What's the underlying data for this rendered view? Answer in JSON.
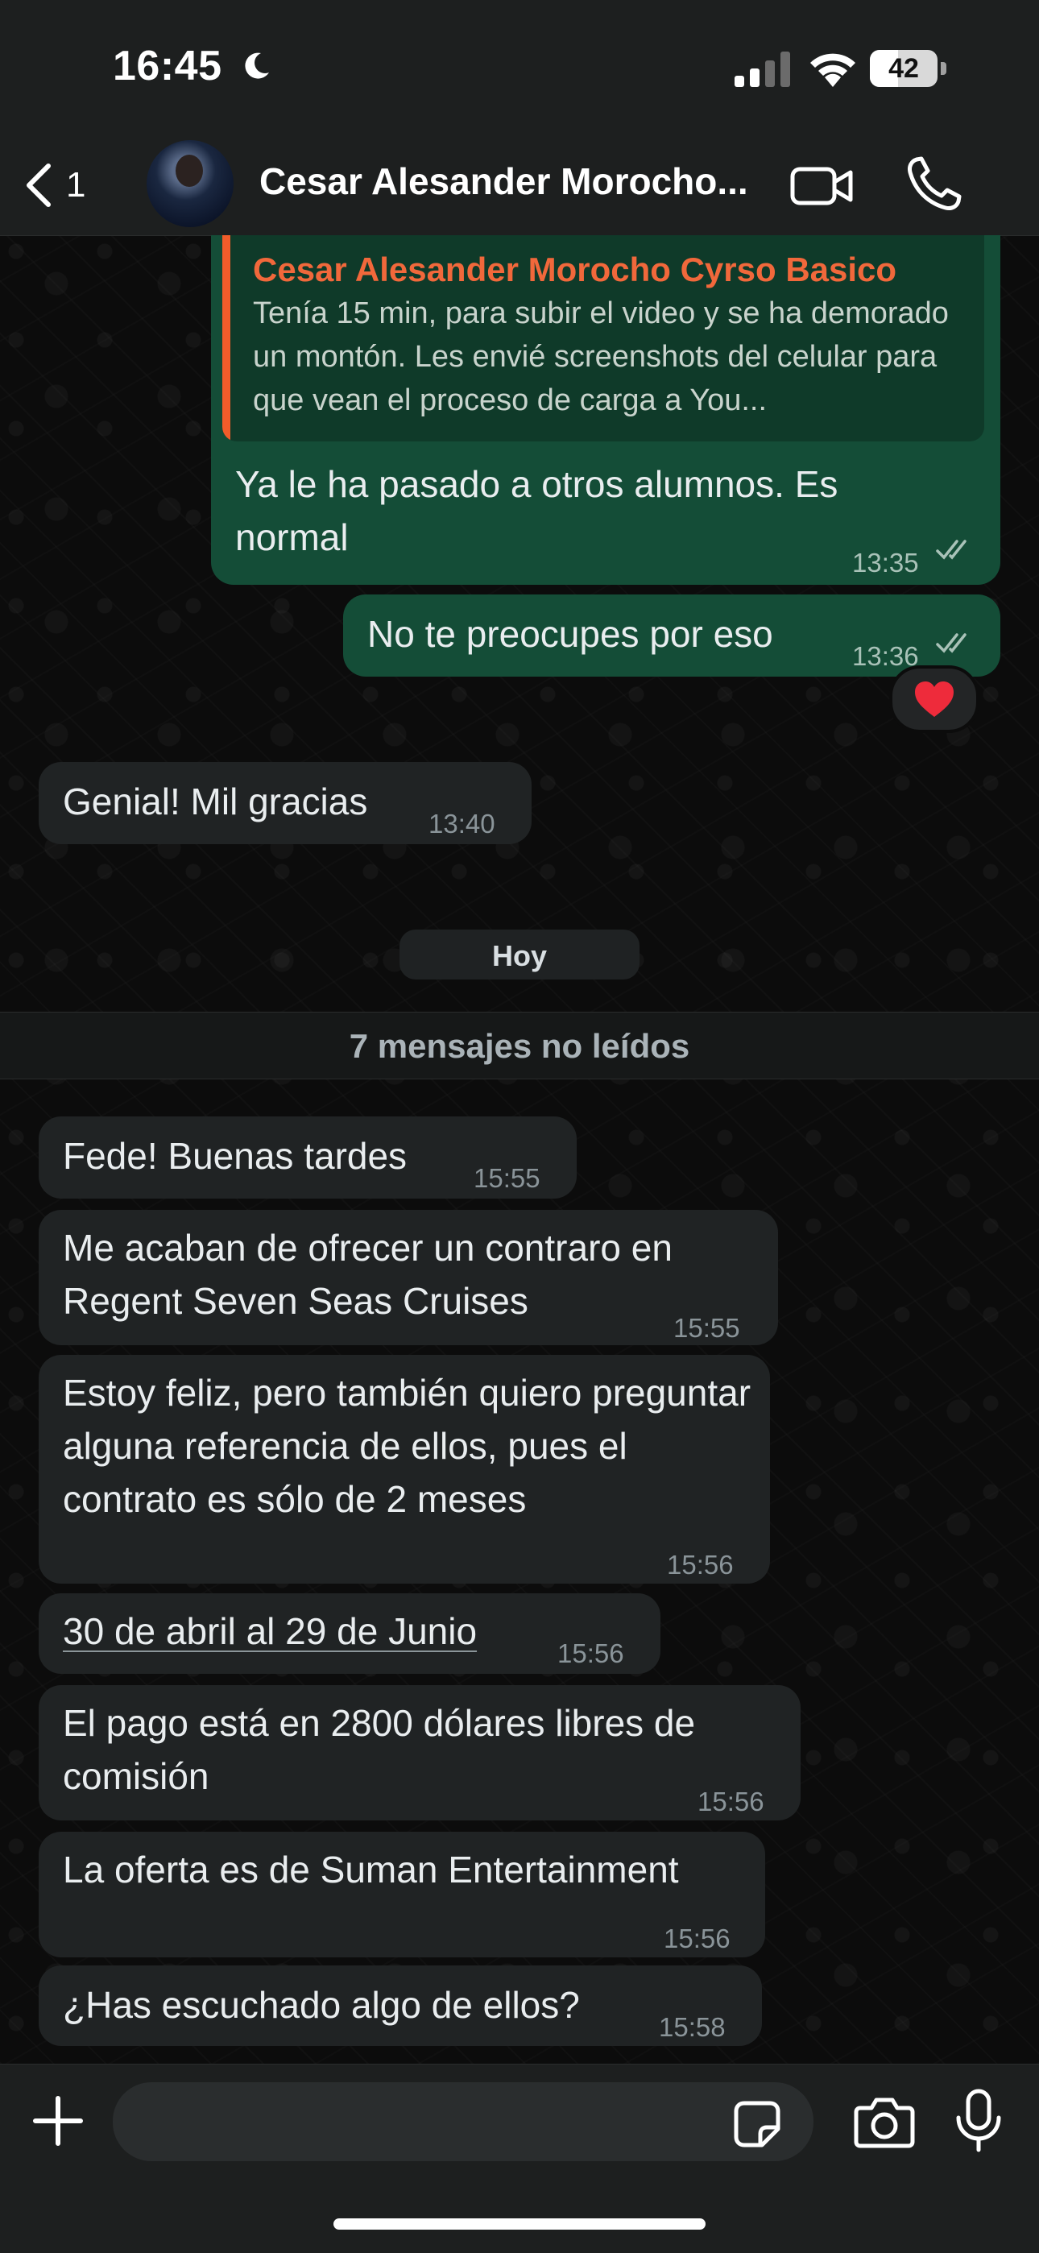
{
  "status_bar": {
    "time": "16:45",
    "battery": "42",
    "battery_level": 0.42
  },
  "header": {
    "back_count": "1",
    "contact_name": "Cesar Alesander Morocho..."
  },
  "messages": [
    {
      "direction": "out",
      "quote_author": "Cesar Alesander Morocho Cyrso Basico",
      "quote_text": "Tenía 15 min, para subir el video y se ha demorado un montón. Les envié screenshots del celular para que vean el proceso de carga a You...",
      "text": "Ya le ha pasado a otros alumnos. Es normal",
      "time": "13:35",
      "read": true
    },
    {
      "direction": "out",
      "text": "No te preocupes por eso",
      "time": "13:36",
      "read": true,
      "reaction": "❤️"
    },
    {
      "direction": "in",
      "text": "Genial! Mil gracias",
      "time": "13:40"
    },
    {
      "direction": "in",
      "text": "Fede! Buenas tardes",
      "time": "15:55"
    },
    {
      "direction": "in",
      "text": "Me acaban de ofrecer un contraro en Regent Seven Seas Cruises",
      "time": "15:55"
    },
    {
      "direction": "in",
      "text": "Estoy feliz, pero también quiero preguntar alguna referencia de ellos, pues el contrato es sólo de 2 meses",
      "time": "15:56"
    },
    {
      "direction": "in",
      "text": "30 de abril al 29 de Junio",
      "time": "15:56",
      "link": true
    },
    {
      "direction": "in",
      "text": "El pago está en 2800 dólares libres de comisión",
      "time": "15:56"
    },
    {
      "direction": "in",
      "text": "La oferta es de Suman Entertainment",
      "time": "15:56"
    },
    {
      "direction": "in",
      "text": "¿Has escuchado algo de ellos?",
      "time": "15:58"
    }
  ],
  "date_separator": "Hoy",
  "unread_banner": "7 mensajes no leídos",
  "input": {
    "placeholder": ""
  },
  "colors": {
    "outgoing_bubble": "#144d37",
    "incoming_bubble": "#202324",
    "quote_accent": "#f15c2a",
    "background": "#0c0c0c"
  },
  "icons": [
    "moon-icon",
    "signal-icon",
    "wifi-icon",
    "battery-icon",
    "back-chevron-icon",
    "video-call-icon",
    "phone-icon",
    "double-check-icon",
    "heart-icon",
    "plus-icon",
    "sticker-icon",
    "camera-icon",
    "microphone-icon"
  ]
}
